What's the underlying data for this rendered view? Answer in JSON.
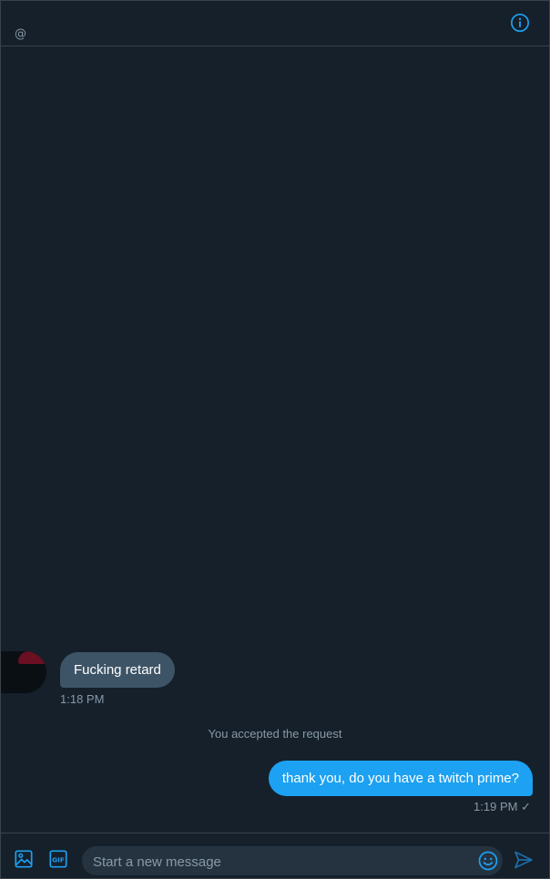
{
  "header": {
    "handle": "@",
    "info_icon": "info-icon"
  },
  "conversation": {
    "incoming": {
      "text": "Fucking retard",
      "time": "1:18 PM"
    },
    "system_message": "You accepted the request",
    "outgoing": {
      "text": "thank you, do you have a twitch prime?",
      "time": "1:19 PM",
      "status_icon": "✓"
    }
  },
  "composer": {
    "placeholder": "Start a new message",
    "value": "",
    "media_icon": "image-icon",
    "gif_label": "GIF",
    "emoji_icon": "emoji-icon",
    "send_icon": "send-icon"
  },
  "colors": {
    "background": "#15202b",
    "accent": "#1da1f2",
    "incoming_bubble": "#3d5466",
    "muted_text": "#8899a6",
    "border": "#38444d"
  }
}
